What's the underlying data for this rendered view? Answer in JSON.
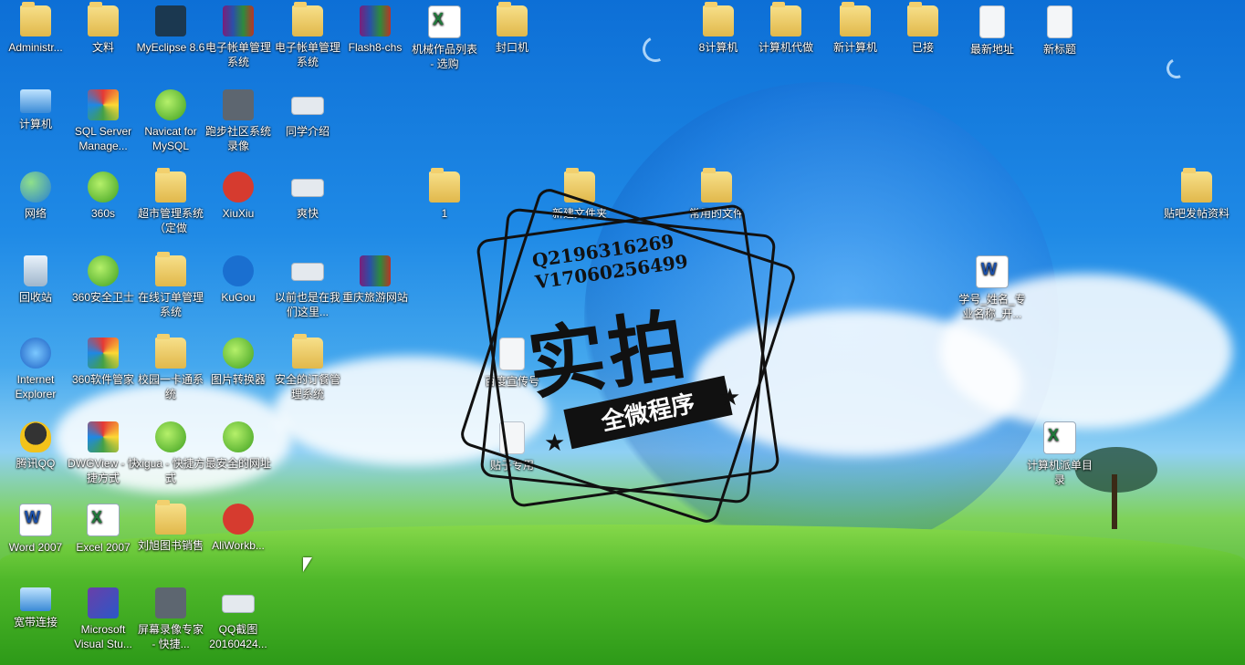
{
  "desktop": {
    "icons": [
      {
        "label": "Administr...",
        "type": "folder"
      },
      {
        "label": "文料",
        "type": "folder"
      },
      {
        "label": "MyEclipse 8.6",
        "type": "dark"
      },
      {
        "label": "电子帐单管理系统",
        "type": "rar"
      },
      {
        "label": "电子帐单管理系统",
        "type": "folder"
      },
      {
        "label": "Flash8-chs",
        "type": "rar"
      },
      {
        "label": "机械作品列表 - 选购",
        "type": "excel"
      },
      {
        "label": "封口机",
        "type": "folder"
      },
      {
        "label": "8计算机",
        "type": "folder"
      },
      {
        "label": "计算机代做",
        "type": "folder"
      },
      {
        "label": "新计算机",
        "type": "folder"
      },
      {
        "label": "已接",
        "type": "folder"
      },
      {
        "label": "最新地址",
        "type": "doc"
      },
      {
        "label": "新标题",
        "type": "doc"
      },
      {
        "label": "计算机",
        "type": "pc"
      },
      {
        "label": "SQL Server Manage...",
        "type": "colorful"
      },
      {
        "label": "Navicat for MySQL",
        "type": "green"
      },
      {
        "label": "跑步社区系统录像",
        "type": "cam"
      },
      {
        "label": "同学介绍",
        "type": "card"
      },
      {
        "label": "网络",
        "type": "globe"
      },
      {
        "label": "360s",
        "type": "green"
      },
      {
        "label": "超市管理系统（定做",
        "type": "folder"
      },
      {
        "label": "XiuXiu",
        "type": "red"
      },
      {
        "label": "爽快",
        "type": "card"
      },
      {
        "label": "1",
        "type": "folder"
      },
      {
        "label": "新建文件夹",
        "type": "folder"
      },
      {
        "label": "常用的文件",
        "type": "folder"
      },
      {
        "label": "贴吧发帖资料",
        "type": "folder"
      },
      {
        "label": "回收站",
        "type": "recycle"
      },
      {
        "label": "360安全卫士",
        "type": "green"
      },
      {
        "label": "在线订单管理系统",
        "type": "folder"
      },
      {
        "label": "KuGou",
        "type": "blue"
      },
      {
        "label": "以前也是在我们这里...",
        "type": "card"
      },
      {
        "label": "重庆旅游网站",
        "type": "rar"
      },
      {
        "label": "学号_姓名_专业名称_开...",
        "type": "word"
      },
      {
        "label": "Internet Explorer",
        "type": "ie"
      },
      {
        "label": "360软件管家",
        "type": "colorful"
      },
      {
        "label": "校园一卡通系统",
        "type": "folder"
      },
      {
        "label": "图片转换器",
        "type": "green"
      },
      {
        "label": "安全的订餐管理系统",
        "type": "folder"
      },
      {
        "label": "百度宣传号",
        "type": "doc"
      },
      {
        "label": "腾讯QQ",
        "type": "qq"
      },
      {
        "label": "DWGView - 快捷方式",
        "type": "colorful"
      },
      {
        "label": "xigua - 快捷方式",
        "type": "green"
      },
      {
        "label": "最安全的网址",
        "type": "green"
      },
      {
        "label": "贴子专用",
        "type": "doc"
      },
      {
        "label": "计算机派单目录",
        "type": "excel"
      },
      {
        "label": "Word 2007",
        "type": "word"
      },
      {
        "label": "Excel 2007",
        "type": "excel"
      },
      {
        "label": "刘旭图书销售",
        "type": "folder"
      },
      {
        "label": "AliWorkb...",
        "type": "red"
      },
      {
        "label": "宽带连接",
        "type": "pc"
      },
      {
        "label": "Microsoft Visual Stu...",
        "type": "ms"
      },
      {
        "label": "屏幕录像专家 - 快捷...",
        "type": "cam"
      },
      {
        "label": "QQ截图20160424...",
        "type": "card"
      }
    ]
  },
  "watermark": {
    "qq": "Q2196316269",
    "v": "V17060256499",
    "main": "实拍",
    "ribbon": "全微程序"
  }
}
